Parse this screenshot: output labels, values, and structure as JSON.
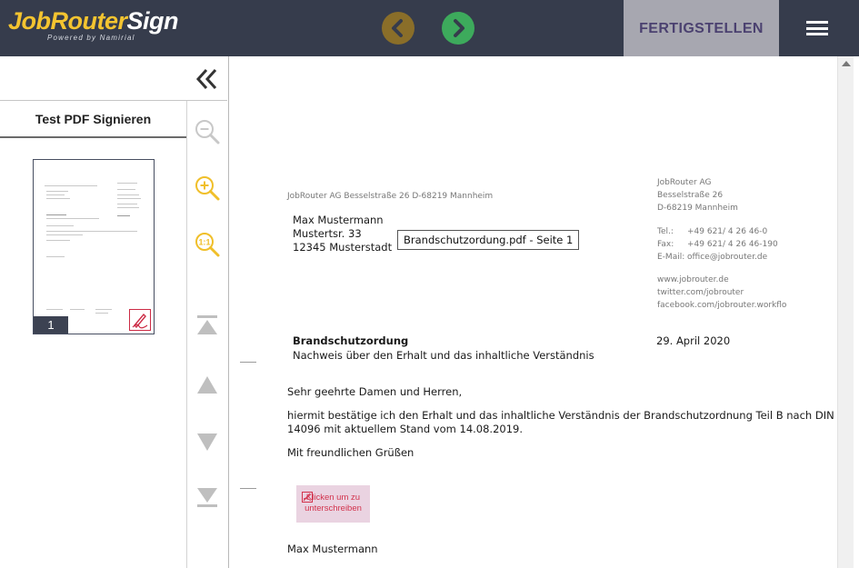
{
  "header": {
    "logo_main": "JobRouter",
    "logo_sign": "Sign",
    "logo_tagline": "Powered by Namirial",
    "prev_icon": "chevron-left-icon",
    "next_icon": "chevron-right-icon",
    "finish_label": "FERTIGSTELLEN",
    "menu_icon": "hamburger-menu-icon",
    "colors": {
      "bar": "#363c4c",
      "prev": "#8a6e29",
      "next": "#3daa5c",
      "finish_bg": "#a7a7b0",
      "finish_text": "#4b4170",
      "logo": "#f4c430"
    }
  },
  "sidebar": {
    "collapse_icon": "double-chevron-left-icon",
    "document_title": "Test PDF Signieren",
    "thumbnail": {
      "page_number": "1",
      "sign_icon": "signature-icon"
    },
    "tools": [
      {
        "name": "zoom-out-icon",
        "enabled": false
      },
      {
        "name": "zoom-in-icon",
        "enabled": true
      },
      {
        "name": "zoom-reset-icon",
        "label": "1:1",
        "enabled": true
      },
      {
        "name": "first-page-icon",
        "enabled": false
      },
      {
        "name": "previous-page-icon",
        "enabled": false
      },
      {
        "name": "next-page-icon",
        "enabled": false
      },
      {
        "name": "last-page-icon",
        "enabled": false
      }
    ]
  },
  "document": {
    "sender_line": "JobRouter AG   Besselstraße 26   D-68219 Mannheim",
    "recipient": [
      "Max Mustermann",
      "Mustertsr. 33",
      "12345 Musterstadt"
    ],
    "tooltip": "Brandschutzordung.pdf - Seite 1",
    "company_block": [
      "JobRouter AG",
      "Besselstraße 26",
      "D-68219 Mannheim"
    ],
    "contact": [
      {
        "label": "Tel.:",
        "value": "+49 621/ 4 26 46-0"
      },
      {
        "label": "Fax:",
        "value": "+49 621/ 4 26 46-190"
      },
      {
        "label": "E-Mail:",
        "value": "office@jobrouter.de"
      }
    ],
    "links": [
      "www.jobrouter.de",
      "twitter.com/jobrouter",
      "facebook.com/jobrouter.workflo"
    ],
    "subject": "Brandschutzordung",
    "subject_sub": "Nachweis über den Erhalt und das inhaltliche Verständnis",
    "date": "29. April 2020",
    "salutation": "Sehr geehrte Damen und Herren,",
    "body_line1": "hiermit bestätige ich den Erhalt und das inhaltliche Verständnis der Brandschutzordnung Teil B nach DIN",
    "body_line2": "14096 mit aktuellem Stand vom 14.08.2019.",
    "closing": "Mit freundlichen Grüßen",
    "signature_field": {
      "line1": "Klicken um zu",
      "line2": "unterschreiben",
      "icon": "signature-icon"
    },
    "signer": "Max Mustermann"
  }
}
